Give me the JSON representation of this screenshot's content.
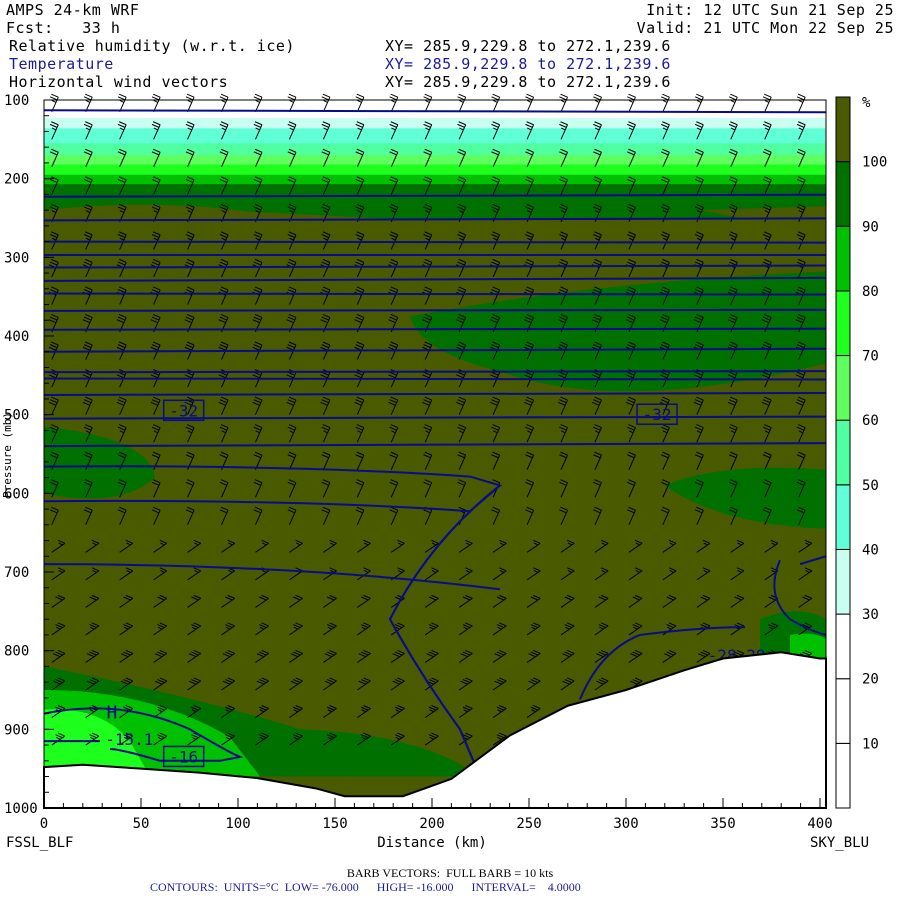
{
  "header": {
    "model": "AMPS 24-km WRF",
    "forecast": "Fcst:   33 h",
    "init": "Init: 12 UTC Sun 21 Sep 25",
    "valid": "Valid: 21 UTC Mon 22 Sep 25",
    "fields": [
      {
        "name": "Relative humidity (w.r.t. ice)",
        "xy": "XY= 285.9,229.8 to 272.1,239.6"
      },
      {
        "name": "Temperature",
        "xy": "XY= 285.9,229.8 to 272.1,239.6"
      },
      {
        "name": "Horizontal wind vectors",
        "xy": "XY= 285.9,229.8 to 272.1,239.6"
      }
    ]
  },
  "footer": {
    "barb": "BARB VECTORS:  FULL BARB = 10 kts",
    "contours": "CONTOURS:  UNITS=°C  LOW= -76.000      HIGH= -16.000      INTERVAL=    4.0000"
  },
  "colors": {
    "contour": "#0a0a8c",
    "olive": "#4a5a00",
    "bands": [
      "#ffffff",
      "#ffffff",
      "#ffffff",
      "#c8fff0",
      "#60ffd8",
      "#50ffa0",
      "#60ff60",
      "#1eff1e",
      "#00c000",
      "#007000",
      "#4a5a00"
    ]
  },
  "chart_data": {
    "type": "heatmap",
    "title": "Cross-section: Relative humidity (w.r.t. ice), Temperature, Horizontal wind",
    "xlabel": "Distance (km)",
    "ylabel": "Pressure (mb)",
    "xlim": [
      0,
      400
    ],
    "ylim": [
      1000,
      100
    ],
    "x_ticks": [
      "0",
      "50",
      "100",
      "150",
      "200",
      "250",
      "300",
      "350",
      "400"
    ],
    "y_ticks": [
      "100",
      "200",
      "300",
      "400",
      "500",
      "600",
      "700",
      "800",
      "900",
      "1000"
    ],
    "x_end_labels": {
      "left": "FSSL_BLF",
      "right": "SKY_BLU"
    },
    "colorbar": {
      "unit": "%",
      "ticks": [
        "10",
        "20",
        "30",
        "40",
        "50",
        "60",
        "70",
        "80",
        "90",
        "100"
      ]
    },
    "isotherm_levels_mb": [
      113,
      223,
      253,
      280,
      297,
      313,
      330,
      346,
      368,
      392,
      420,
      446,
      454,
      475,
      505,
      540,
      566,
      610
    ],
    "contour_labels": [
      {
        "text": "-32",
        "x_km": 72,
        "p_mb": 497
      },
      {
        "text": "-32",
        "x_km": 316,
        "p_mb": 502
      },
      {
        "text": "H",
        "x_km": 35,
        "p_mb": 881
      },
      {
        "text": "-15.1",
        "x_km": 44,
        "p_mb": 915
      },
      {
        "text": "-16",
        "x_km": 72,
        "p_mb": 937
      },
      {
        "text": "-28.29",
        "x_km": 357,
        "p_mb": 808
      }
    ],
    "terrain_mb": [
      [
        0,
        948
      ],
      [
        20,
        945
      ],
      [
        50,
        950
      ],
      [
        80,
        955
      ],
      [
        110,
        962
      ],
      [
        140,
        975
      ],
      [
        155,
        985
      ],
      [
        185,
        985
      ],
      [
        210,
        963
      ],
      [
        240,
        908
      ],
      [
        270,
        870
      ],
      [
        300,
        850
      ],
      [
        330,
        825
      ],
      [
        350,
        810
      ],
      [
        380,
        802
      ],
      [
        400,
        810
      ]
    ],
    "wind": {
      "levels_mb": [
        115,
        150,
        185,
        220,
        255,
        290,
        325,
        360,
        395,
        430,
        465,
        500,
        535,
        570,
        605,
        640,
        675,
        710,
        745,
        780,
        815,
        850,
        885,
        920
      ],
      "speed_kts": [
        25,
        25,
        20,
        20,
        25,
        25,
        30,
        30,
        30,
        30,
        30,
        30,
        25,
        20,
        20,
        20,
        15,
        15,
        20,
        25,
        30,
        30,
        25,
        25
      ]
    }
  }
}
